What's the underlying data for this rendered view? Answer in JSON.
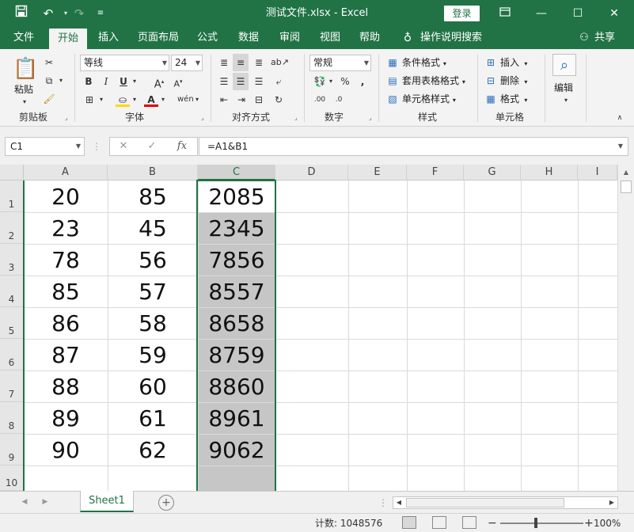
{
  "titlebar": {
    "save_icon": "save-icon",
    "undo_icon": "undo-icon",
    "redo_icon": "redo-icon",
    "title": "测试文件.xlsx  -  Excel",
    "login_label": "登录",
    "ribbon_display_icon": "ribbon-display-icon",
    "minimize_icon": "minimize-icon",
    "maximize_icon": "maximize-icon",
    "close_icon": "close-icon"
  },
  "menu": {
    "tabs": [
      "文件",
      "开始",
      "插入",
      "页面布局",
      "公式",
      "数据",
      "审阅",
      "视图",
      "帮助"
    ],
    "active_tab": "开始",
    "search_label": "操作说明搜索",
    "share_label": "共享"
  },
  "ribbon": {
    "clipboard": {
      "label": "剪贴板",
      "paste_label": "粘贴"
    },
    "font": {
      "label": "字体",
      "font_name": "等线",
      "font_size": "24"
    },
    "alignment": {
      "label": "对齐方式"
    },
    "number": {
      "label": "数字",
      "format": "常规"
    },
    "styles": {
      "label": "样式",
      "conditional": "条件格式",
      "table_format": "套用表格格式",
      "cell_styles": "单元格样式"
    },
    "cells": {
      "label": "单元格",
      "insert": "插入",
      "delete": "删除",
      "format": "格式"
    },
    "editing": {
      "label": "编辑"
    }
  },
  "formula_bar": {
    "name_box": "C1",
    "formula": "=A1&B1"
  },
  "grid": {
    "columns": [
      "A",
      "B",
      "C",
      "D",
      "E",
      "F",
      "G",
      "H",
      "I"
    ],
    "selected_column": "C",
    "rows": [
      "1",
      "2",
      "3",
      "4",
      "5",
      "6",
      "7",
      "8",
      "9",
      "10"
    ],
    "data": [
      [
        "20",
        "85",
        "2085"
      ],
      [
        "23",
        "45",
        "2345"
      ],
      [
        "78",
        "56",
        "7856"
      ],
      [
        "85",
        "57",
        "8557"
      ],
      [
        "86",
        "58",
        "8658"
      ],
      [
        "87",
        "59",
        "8759"
      ],
      [
        "88",
        "60",
        "8860"
      ],
      [
        "89",
        "61",
        "8961"
      ],
      [
        "90",
        "62",
        "9062"
      ]
    ]
  },
  "sheets": {
    "tabs": [
      "Sheet1"
    ],
    "active": "Sheet1"
  },
  "status": {
    "count_label": "计数: 1048576",
    "zoom": "100%"
  },
  "colors": {
    "accent": "#217346",
    "selection_fill": "#c6c6c6"
  }
}
